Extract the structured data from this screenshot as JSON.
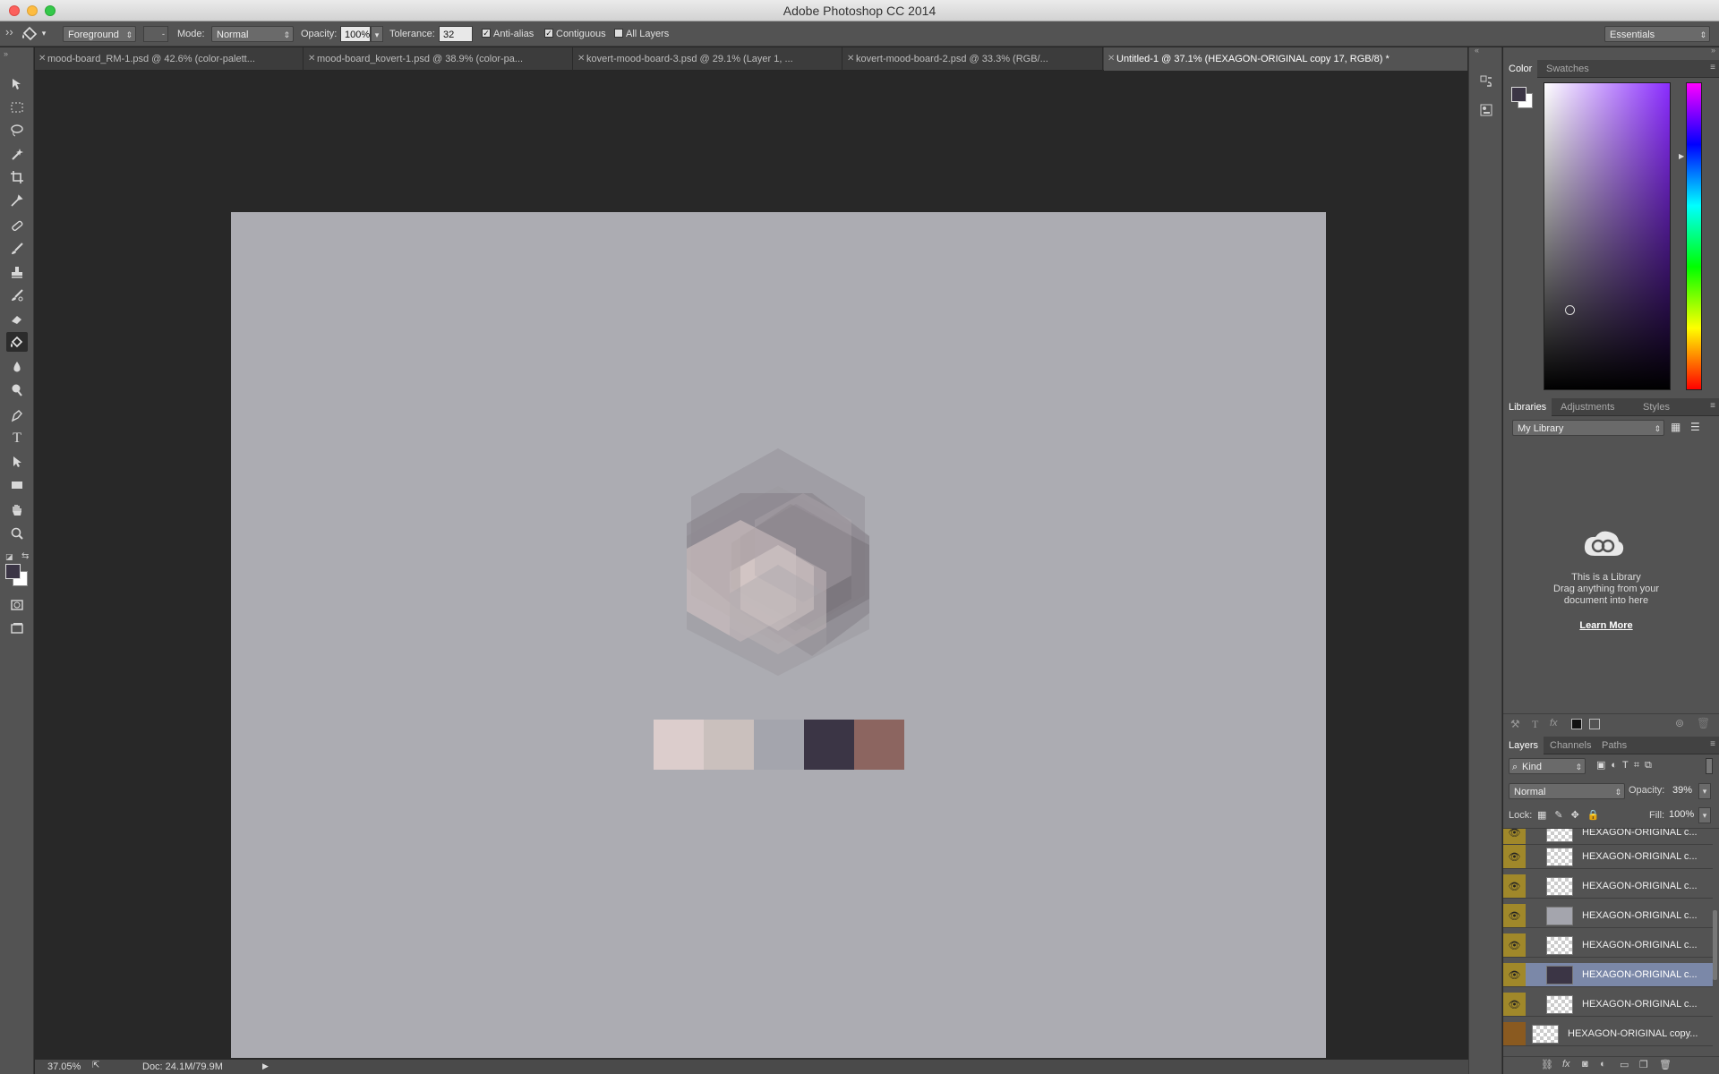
{
  "app": {
    "title": "Adobe Photoshop CC 2014"
  },
  "options_bar": {
    "fill_source": "Foreground",
    "mode_label": "Mode:",
    "mode_value": "Normal",
    "opacity_label": "Opacity:",
    "opacity_value": "100%",
    "tolerance_label": "Tolerance:",
    "tolerance_value": "32",
    "anti_alias_label": "Anti-alias",
    "anti_alias_checked": true,
    "contiguous_label": "Contiguous",
    "contiguous_checked": true,
    "all_layers_label": "All Layers",
    "all_layers_checked": false,
    "workspace": "Essentials"
  },
  "tabs": [
    {
      "label": "mood-board_RM-1.psd @ 42.6% (color-palett...",
      "active": false
    },
    {
      "label": "mood-board_kovert-1.psd @ 38.9% (color-pa...",
      "active": false
    },
    {
      "label": "kovert-mood-board-3.psd @ 29.1% (Layer 1, ...",
      "active": false
    },
    {
      "label": "kovert-mood-board-2.psd @ 33.3% (RGB/...",
      "active": false
    },
    {
      "label": "Untitled-1 @ 37.1% (HEXAGON-ORIGINAL copy 17, RGB/8) *",
      "active": true
    }
  ],
  "tools": [
    "move-tool",
    "marquee-tool",
    "lasso-tool",
    "magic-wand-tool",
    "crop-tool",
    "eyedropper-tool",
    "healing-brush-tool",
    "brush-tool",
    "clone-stamp-tool",
    "history-brush-tool",
    "eraser-tool",
    "paint-bucket-tool",
    "blur-tool",
    "dodge-tool",
    "pen-tool",
    "type-tool",
    "path-selection-tool",
    "rectangle-tool",
    "hand-tool",
    "zoom-tool"
  ],
  "canvas": {
    "background": "#acacb2",
    "palette": [
      "#dccdcc",
      "#cac0bd",
      "#a4a5ad",
      "#3b3545",
      "#8c6560"
    ]
  },
  "status": {
    "zoom": "37.05%",
    "doc": "Doc: 24.1M/79.9M"
  },
  "color_panel": {
    "tabs": [
      "Color",
      "Swatches"
    ],
    "foreground": "#3b3545",
    "background": "#ffffff"
  },
  "libraries_panel": {
    "tabs": [
      "Libraries",
      "Adjustments",
      "Styles"
    ],
    "library_select": "My Library",
    "empty_line1": "This is a Library",
    "empty_line2": "Drag anything from your",
    "empty_line3": "document into here",
    "learn_more": "Learn More"
  },
  "layers_panel": {
    "tabs": [
      "Layers",
      "Channels",
      "Paths"
    ],
    "filter": "Kind",
    "blend_mode": "Normal",
    "opacity_label": "Opacity:",
    "opacity_value": "39%",
    "lock_label": "Lock:",
    "fill_label": "Fill:",
    "fill_value": "100%",
    "layers": [
      {
        "name": "HEXAGON-ORIGINAL c...",
        "selected": false
      },
      {
        "name": "HEXAGON-ORIGINAL c...",
        "selected": false
      },
      {
        "name": "HEXAGON-ORIGINAL c...",
        "selected": false
      },
      {
        "name": "HEXAGON-ORIGINAL c...",
        "selected": false
      },
      {
        "name": "HEXAGON-ORIGINAL c...",
        "selected": false
      },
      {
        "name": "HEXAGON-ORIGINAL c...",
        "selected": true
      },
      {
        "name": "HEXAGON-ORIGINAL c...",
        "selected": false
      },
      {
        "name": "HEXAGON-ORIGINAL copy...",
        "selected": false
      }
    ]
  }
}
